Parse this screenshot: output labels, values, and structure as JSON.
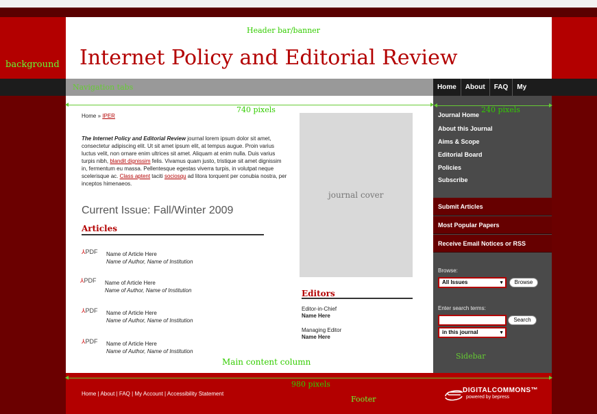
{
  "labels": {
    "background": "background",
    "header": "Header bar/banner",
    "navigation": "Navigation tabs",
    "main": "Main content column",
    "sidebar": "Sidebar",
    "footer": "Footer",
    "cover": "journal cover"
  },
  "measurements": {
    "main_width": "740 pixels",
    "sidebar_width": "240 pixels",
    "page_width": "980 pixels"
  },
  "site_title": "Internet Policy and Editorial Review",
  "nav": {
    "home": "Home",
    "about": "About",
    "faq": "FAQ",
    "account": "My Account"
  },
  "breadcrumb": {
    "home": "Home",
    "separator": "»",
    "current": "IPER"
  },
  "intro": {
    "journal": "The Internet Policy and Editorial Review",
    "text1": " journal lorem ipsum dolor sit amet, consectetur adipiscing elit. Ut sit amet ipsum elit, at tempus augue. Proin varius luctus velit, non ornare enim ultrices sit amet. Aliquam at enim nulla. Duis varius turpis nibh, ",
    "link1": "blandit dignissim",
    "text2": " felis. Vivamus quam justo, tristique sit amet dignissim in, fermentum eu massa. Pellentesque egestas viverra turpis, in volutpat neque scelerisque ac. ",
    "link2": "Class aptent",
    "text3": " taciti ",
    "link3": "sociosqu",
    "text4": " ad litora torquent per conubia nostra, per inceptos himenaeos."
  },
  "issue": "Current Issue: Fall/Winter 2009",
  "articles_heading": "Articles",
  "pdf_label": "PDF",
  "articles": [
    {
      "title": "Name of Article Here",
      "author": "Name of Author, Name of Institution"
    },
    {
      "title": "Name of Article Here",
      "author": "Name of Author, Name of Institution"
    },
    {
      "title": "Name of Article Here",
      "author": "Name of Author, Name of Institution"
    },
    {
      "title": "Name of Article Here",
      "author": "Name of Author, Name of Institution"
    }
  ],
  "editors": {
    "heading": "Editors",
    "chief_role": "Editor-in-Chief",
    "chief_name": "Name Here",
    "managing_role": "Managing Editor",
    "managing_name": "Name Here"
  },
  "sidebar": {
    "links": [
      "Journal Home",
      "About this Journal",
      "Aims & Scope",
      "Editorial Board",
      "Policies",
      "Subscribe"
    ],
    "boxes": [
      "Submit Articles",
      "Most Popular Papers",
      "Receive Email Notices or RSS"
    ],
    "browse_label": "Browse:",
    "browse_select": "All Issues",
    "browse_button": "Browse",
    "search_label": "Enter search terms:",
    "search_value": "",
    "search_button": "Search",
    "scope_select": "in this journal"
  },
  "footer": {
    "links": [
      "Home",
      "About",
      "FAQ",
      "My Account",
      "Accessibility Statement"
    ],
    "separator": "|",
    "brand": "DIGITALCOMMONS™",
    "brand_sub": "powered by bepress"
  },
  "colors": {
    "background": "#6b0000",
    "banner_red": "#b30000",
    "sidebar": "#4a4a4a",
    "annotation": "#66cc33"
  }
}
